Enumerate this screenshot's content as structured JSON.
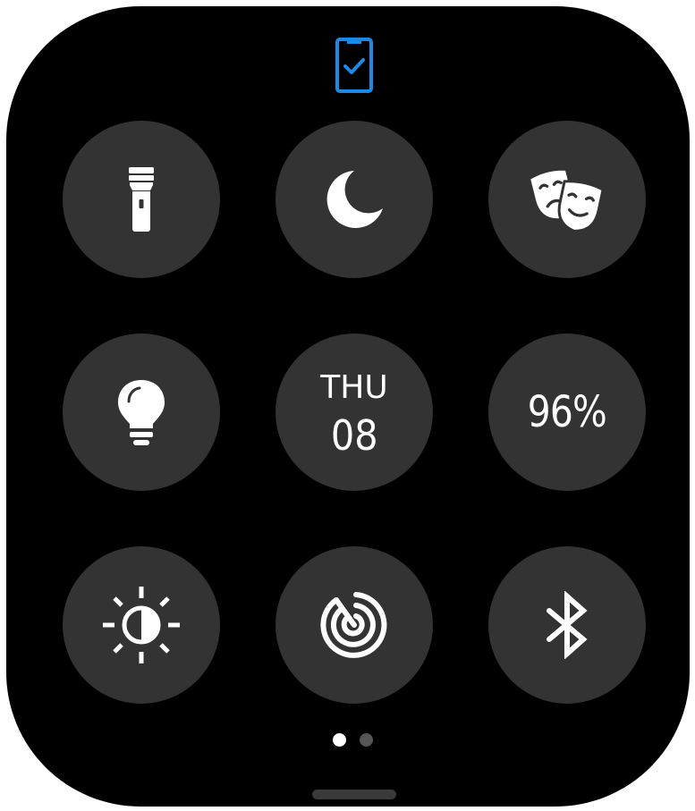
{
  "colors": {
    "background": "#000000",
    "tile": "#333333",
    "accent": "#1E88E5",
    "icon": "#ffffff",
    "pager_inactive": "#555555"
  },
  "status_icon": "phone-connected-icon",
  "tiles": [
    {
      "id": "flashlight",
      "icon": "flashlight-icon"
    },
    {
      "id": "do-not-disturb",
      "icon": "moon-icon"
    },
    {
      "id": "theater-mode",
      "icon": "theater-masks-icon"
    },
    {
      "id": "always-on-display",
      "icon": "lightbulb-icon"
    },
    {
      "id": "date",
      "day": "THU",
      "date": "08"
    },
    {
      "id": "battery",
      "label": "96%"
    },
    {
      "id": "brightness",
      "icon": "brightness-icon"
    },
    {
      "id": "find-phone",
      "icon": "radar-icon"
    },
    {
      "id": "bluetooth",
      "icon": "bluetooth-icon"
    }
  ],
  "pager": {
    "total_pages": 2,
    "current_page": 1
  }
}
